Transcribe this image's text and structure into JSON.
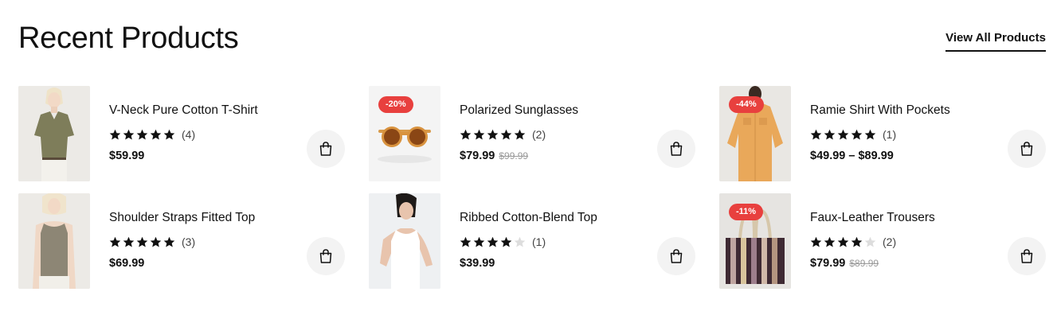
{
  "section": {
    "title": "Recent Products",
    "view_all_label": "View All Products"
  },
  "colors": {
    "badge": "#e8403e",
    "star_filled": "#111111",
    "star_empty": "#dddddd",
    "cart_button_bg": "#f3f3f3"
  },
  "products": [
    {
      "name": "V-Neck Pure Cotton T-Shirt",
      "rating": 5,
      "review_count": "(4)",
      "price": "$59.99",
      "old_price": "",
      "badge": "",
      "icon": "shopping-bag-icon"
    },
    {
      "name": "Polarized Sunglasses",
      "rating": 5,
      "review_count": "(2)",
      "price": "$79.99",
      "old_price": "$99.99",
      "badge": "-20%",
      "icon": "shopping-bag-icon"
    },
    {
      "name": "Ramie Shirt With Pockets",
      "rating": 5,
      "review_count": "(1)",
      "price": "$49.99 – $89.99",
      "old_price": "",
      "badge": "-44%",
      "icon": "shopping-bag-icon"
    },
    {
      "name": "Shoulder Straps Fitted Top",
      "rating": 5,
      "review_count": "(3)",
      "price": "$69.99",
      "old_price": "",
      "badge": "",
      "icon": "shopping-bag-icon"
    },
    {
      "name": "Ribbed Cotton-Blend Top",
      "rating": 4,
      "review_count": "(1)",
      "price": "$39.99",
      "old_price": "",
      "badge": "",
      "icon": "shopping-bag-icon"
    },
    {
      "name": "Faux-Leather Trousers",
      "rating": 4,
      "review_count": "(2)",
      "price": "$79.99",
      "old_price": "$89.99",
      "badge": "-11%",
      "icon": "shopping-bag-icon"
    }
  ]
}
